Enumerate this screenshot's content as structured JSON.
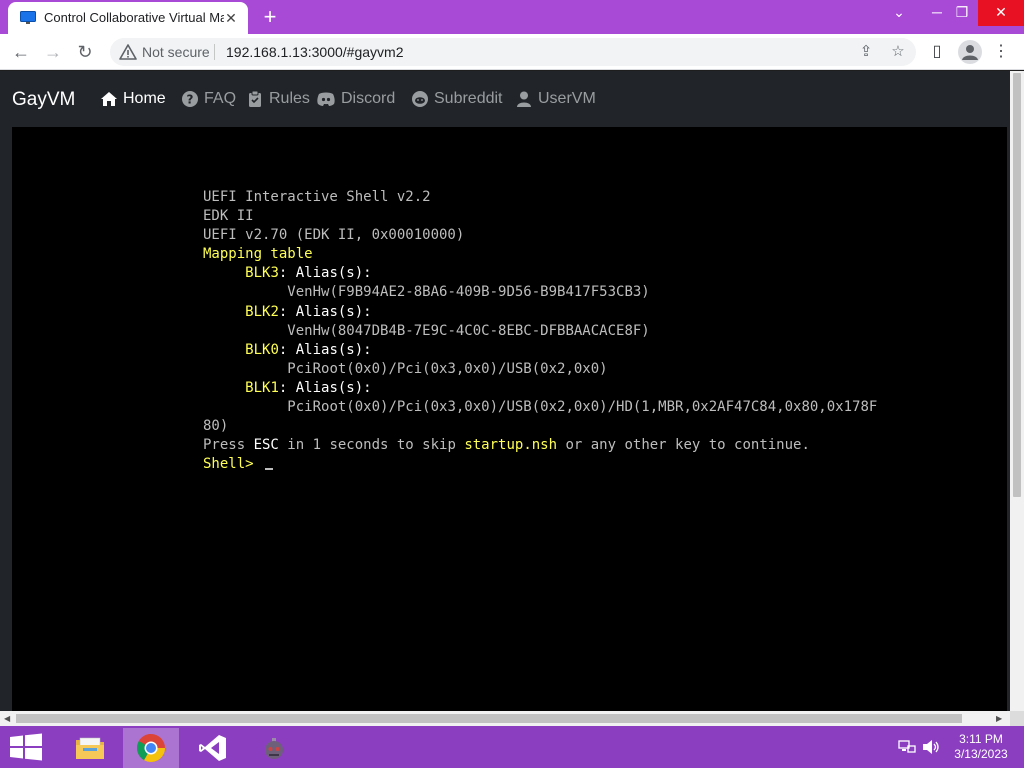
{
  "browser": {
    "tab_title": "Control Collaborative Virtual Machine",
    "new_tab_label": "+",
    "security_label": "Not secure",
    "url": "192.168.1.13:3000/#gayvm2"
  },
  "nav": {
    "brand": "GayVM",
    "items": [
      {
        "label": "Home",
        "icon": "home-icon",
        "active": true
      },
      {
        "label": "FAQ",
        "icon": "question-circle-icon"
      },
      {
        "label": "Rules",
        "icon": "clipboard-icon"
      },
      {
        "label": "Discord",
        "icon": "discord-icon"
      },
      {
        "label": "Subreddit",
        "icon": "reddit-icon"
      },
      {
        "label": "UserVM",
        "icon": "user-icon"
      }
    ]
  },
  "terminal": {
    "lines": {
      "l1": "UEFI Interactive Shell v2.2",
      "l2": "EDK II",
      "l3": "UEFI v2.70 (EDK II, 0x00010000)",
      "mapping": "Mapping table",
      "blk3": "BLK3",
      "blk3_dev": "VenHw(F9B94AE2-8BA6-409B-9D56-B9B417F53CB3)",
      "blk2": "BLK2",
      "blk2_dev": "VenHw(8047DB4B-7E9C-4C0C-8EBC-DFBBAACACE8F)",
      "blk0": "BLK0",
      "blk0_dev": "PciRoot(0x0)/Pci(0x3,0x0)/USB(0x2,0x0)",
      "blk1": "BLK1",
      "blk1_dev": "PciRoot(0x0)/Pci(0x3,0x0)/USB(0x2,0x0)/HD(1,MBR,0x2AF47C84,0x80,0x178F",
      "blk1_wrap": "80)",
      "alias": ": Alias(s):",
      "press": "Press ",
      "esc": "ESC",
      "in_seconds": " in 1 seconds to skip ",
      "startup": "startup.nsh",
      "continue": " or any other key to continue.",
      "prompt": "Shell> "
    }
  },
  "taskbar": {
    "time": "3:11 PM",
    "date": "3/13/2023"
  },
  "colors": {
    "accent_purple": "#a84ad6",
    "taskbar_purple": "#8b3fc0",
    "navbar_bg": "#212529",
    "terminal_yellow": "#ffff55",
    "terminal_gray": "#bdbdbd"
  }
}
